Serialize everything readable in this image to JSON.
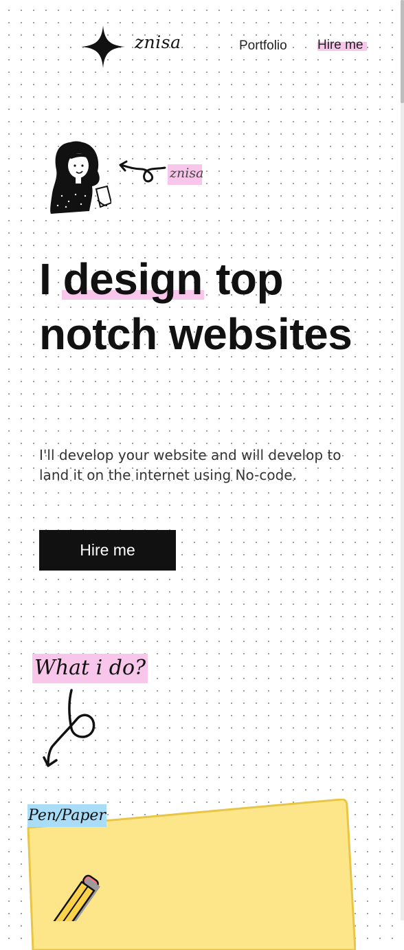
{
  "header": {
    "logo_text": "znisa",
    "nav": {
      "portfolio_label": "Portfolio",
      "hire_label": "Hire me"
    }
  },
  "hero": {
    "name_tag": "znisa",
    "headline": {
      "prefix": "I ",
      "highlight": "design",
      "suffix": " top notch websites"
    },
    "description": "I'll develop your website and will develop to land it on the internet using No-code.",
    "cta_label": "Hire me"
  },
  "services": {
    "heading": "What i do?",
    "card": {
      "label": "Pen/Paper"
    }
  },
  "colors": {
    "highlight_pink": "#f7c6ea",
    "label_blue": "#a8dcf7",
    "card_yellow": "#fde58a",
    "card_border": "#e9c545",
    "button_black": "#111111"
  }
}
